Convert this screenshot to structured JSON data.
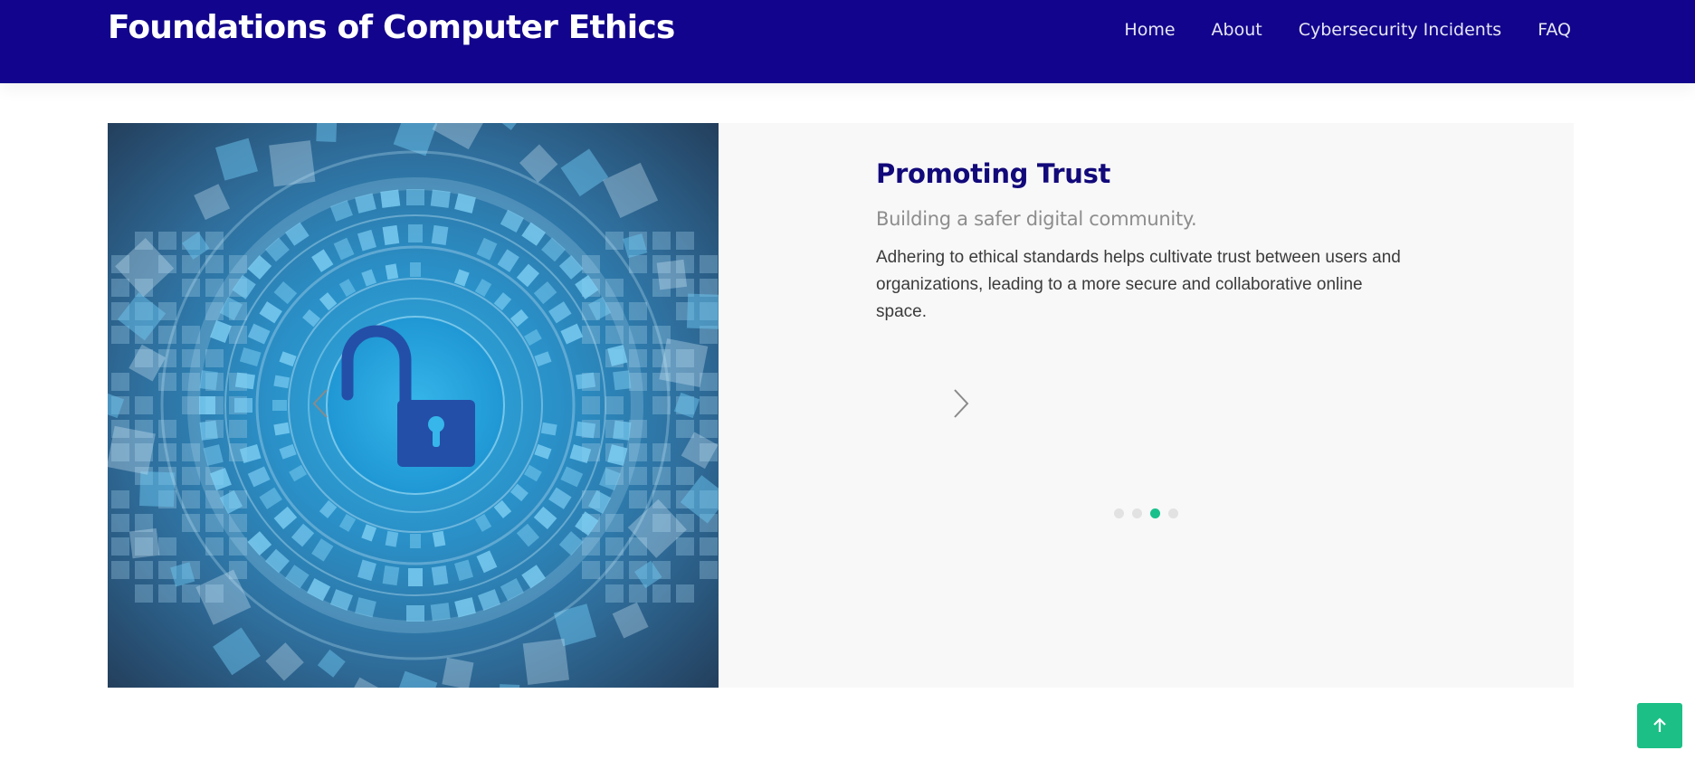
{
  "site": {
    "title": "Foundations of Computer Ethics"
  },
  "nav": [
    {
      "label": "Home"
    },
    {
      "label": "About"
    },
    {
      "label": "Cybersecurity Incidents"
    },
    {
      "label": "FAQ"
    }
  ],
  "slider": {
    "heading": "Promoting Trust",
    "subtitle": "Building a safer digital community.",
    "body": "Adhering to ethical standards helps cultivate trust between users and organizations, leading to a more secure and collaborative online space.",
    "total_slides": 4,
    "active_slide": 3,
    "image_icon": "unlocked-padlock-cyber-icon",
    "prev_icon": "chevron-left-icon",
    "next_icon": "chevron-right-icon"
  },
  "back_to_top": {
    "icon": "arrow-up-icon"
  },
  "colors": {
    "header_bg": "#12048c",
    "heading": "#12097a",
    "accent": "#19c08b",
    "panel_bg": "#f8f8f8"
  }
}
